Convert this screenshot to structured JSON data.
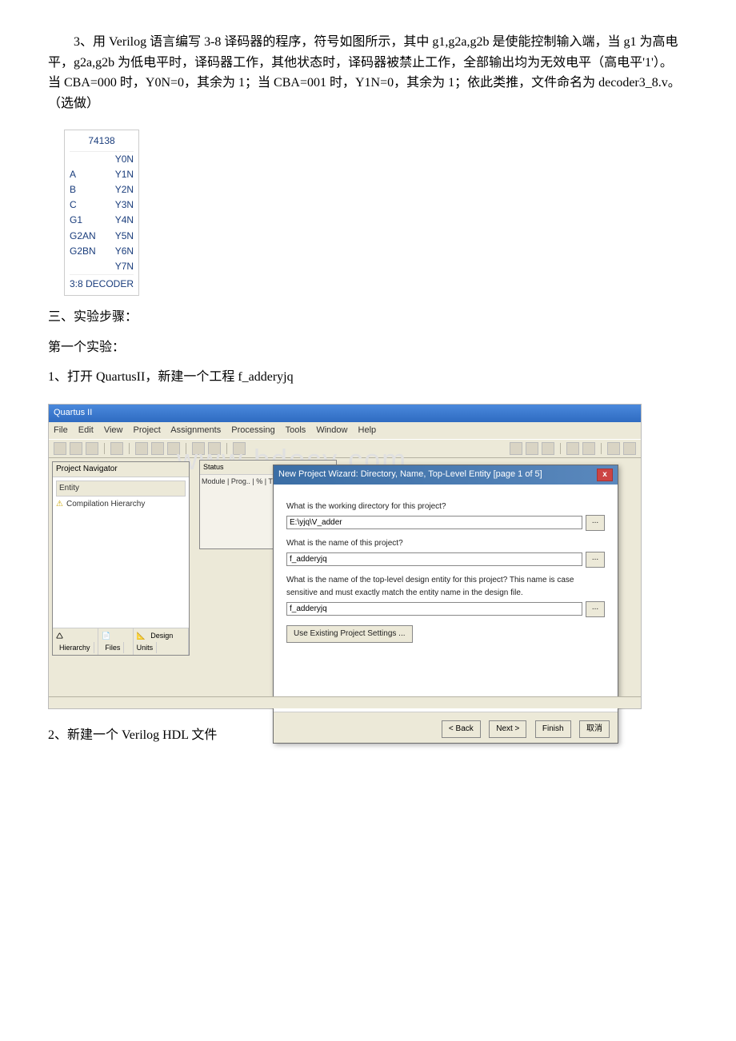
{
  "paragraphs": {
    "p1_prefix": "3、用 Verilog 语言编写 3-8 译码器的程序，符号如图所示，其中 g1,g2a,g2b 是使能控制输入端，当 g1 为高电平，g2a,g2b 为低电平时，译码器工作，其他状态时，译码器被禁止工作，全部输出均为无效电平（高电平'1'）。 当 CBA=000 时，Y0N=0，其余为 1；当 CBA=001 时，Y1N=0，其余为 1；依此类推，文件命名为 decoder3_8.v。（选做）",
    "p2": "三、实验步骤：",
    "p3": "第一个实验：",
    "p4": "1、打开 QuartusII，新建一个工程 f_adderyjq",
    "p5": "2、新建一个 Verilog HDL 文件"
  },
  "ic": {
    "header": "74138",
    "rows": [
      {
        "l": "",
        "r": "Y0N"
      },
      {
        "l": "A",
        "r": "Y1N"
      },
      {
        "l": "B",
        "r": "Y2N"
      },
      {
        "l": "C",
        "r": "Y3N"
      },
      {
        "l": "G1",
        "r": "Y4N"
      },
      {
        "l": "G2AN",
        "r": "Y5N"
      },
      {
        "l": "G2BN",
        "r": "Y6N"
      },
      {
        "l": "",
        "r": "Y7N"
      }
    ],
    "footer": "3:8 DECODER"
  },
  "quartus": {
    "title": "Quartus II",
    "menu": [
      "File",
      "Edit",
      "View",
      "Project",
      "Assignments",
      "Processing",
      "Tools",
      "Window",
      "Help"
    ],
    "nav": {
      "header": "Project Navigator",
      "entity": "Entity",
      "hierarchy": "Compilation Hierarchy",
      "tabs": [
        "Hierarchy",
        "Files",
        "Design Units"
      ]
    },
    "status": {
      "header": "Status",
      "cols": "Module   | Prog.. | % | Time O"
    }
  },
  "wizard": {
    "title": "New Project Wizard: Directory, Name, Top-Level Entity [page 1 of 5]",
    "closeLabel": "x",
    "q1": "What is the working directory for this project?",
    "dir": "E:\\yjq\\V_adder",
    "q2": "What is the name of this project?",
    "name": "f_adderyjq",
    "q3": "What is the name of the top-level design entity for this project? This name is case sensitive and must exactly match the entity name in the design file.",
    "top": "f_adderyjq",
    "useExisting": "Use Existing Project Settings ...",
    "buttons": {
      "back": "< Back",
      "next": "Next >",
      "finish": "Finish",
      "cancel": "取消"
    }
  },
  "watermark": "www bdocy com"
}
